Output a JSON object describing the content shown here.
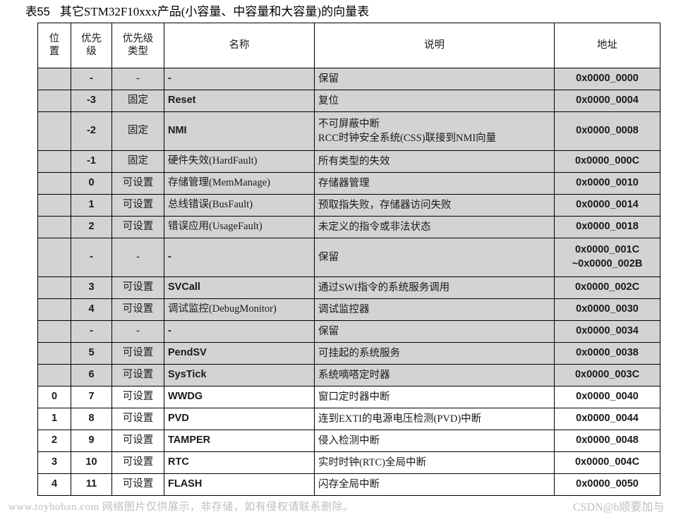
{
  "caption": {
    "number": "表55",
    "text": "其它STM32F10xxx产品(小容量、中容量和大容量)的向量表"
  },
  "table": {
    "headers": {
      "position_l1": "位",
      "position_l2": "置",
      "priority_l1": "优先",
      "priority_l2": "级",
      "priority_type_l1": "优先级",
      "priority_type_l2": "类型",
      "name": "名称",
      "description": "说明",
      "address": "地址"
    },
    "rows": [
      {
        "position": "",
        "priority": "-",
        "priority_type": "-",
        "name": "-",
        "name_cjk": false,
        "desc_lines": [
          "保留"
        ],
        "addr_lines": [
          "0x0000_0000"
        ],
        "shaded": true,
        "tall": false
      },
      {
        "position": "",
        "priority": "-3",
        "priority_type": "固定",
        "name": "Reset",
        "name_cjk": false,
        "desc_lines": [
          "复位"
        ],
        "addr_lines": [
          "0x0000_0004"
        ],
        "shaded": true,
        "tall": false
      },
      {
        "position": "",
        "priority": "-2",
        "priority_type": "固定",
        "name": "NMI",
        "name_cjk": false,
        "desc_lines": [
          "不可屏蔽中断",
          "RCC时钟安全系统(CSS)联接到NMI向量"
        ],
        "addr_lines": [
          "0x0000_0008"
        ],
        "shaded": true,
        "tall": true
      },
      {
        "position": "",
        "priority": "-1",
        "priority_type": "固定",
        "name": "硬件失效(HardFault)",
        "name_cjk": true,
        "desc_lines": [
          "所有类型的失效"
        ],
        "addr_lines": [
          "0x0000_000C"
        ],
        "shaded": true,
        "tall": false
      },
      {
        "position": "",
        "priority": "0",
        "priority_type": "可设置",
        "name": "存储管理(MemManage)",
        "name_cjk": true,
        "desc_lines": [
          "存储器管理"
        ],
        "addr_lines": [
          "0x0000_0010"
        ],
        "shaded": true,
        "tall": false
      },
      {
        "position": "",
        "priority": "1",
        "priority_type": "可设置",
        "name": "总线错误(BusFault)",
        "name_cjk": true,
        "desc_lines": [
          "预取指失败，存储器访问失败"
        ],
        "addr_lines": [
          "0x0000_0014"
        ],
        "shaded": true,
        "tall": false
      },
      {
        "position": "",
        "priority": "2",
        "priority_type": "可设置",
        "name": "错误应用(UsageFault)",
        "name_cjk": true,
        "desc_lines": [
          "未定义的指令或非法状态"
        ],
        "addr_lines": [
          "0x0000_0018"
        ],
        "shaded": true,
        "tall": false
      },
      {
        "position": "",
        "priority": "-",
        "priority_type": "-",
        "name": "-",
        "name_cjk": false,
        "desc_lines": [
          "保留"
        ],
        "addr_lines": [
          "0x0000_001C",
          "~0x0000_002B"
        ],
        "shaded": true,
        "tall": true
      },
      {
        "position": "",
        "priority": "3",
        "priority_type": "可设置",
        "name": "SVCall",
        "name_cjk": false,
        "desc_lines": [
          "通过SWI指令的系统服务调用"
        ],
        "addr_lines": [
          "0x0000_002C"
        ],
        "shaded": true,
        "tall": false
      },
      {
        "position": "",
        "priority": "4",
        "priority_type": "可设置",
        "name": "调试监控(DebugMonitor)",
        "name_cjk": true,
        "desc_lines": [
          "调试监控器"
        ],
        "addr_lines": [
          "0x0000_0030"
        ],
        "shaded": true,
        "tall": false
      },
      {
        "position": "",
        "priority": "-",
        "priority_type": "-",
        "name": "-",
        "name_cjk": false,
        "desc_lines": [
          "保留"
        ],
        "addr_lines": [
          "0x0000_0034"
        ],
        "shaded": true,
        "tall": false
      },
      {
        "position": "",
        "priority": "5",
        "priority_type": "可设置",
        "name": "PendSV",
        "name_cjk": false,
        "desc_lines": [
          "可挂起的系统服务"
        ],
        "addr_lines": [
          "0x0000_0038"
        ],
        "shaded": true,
        "tall": false
      },
      {
        "position": "",
        "priority": "6",
        "priority_type": "可设置",
        "name": "SysTick",
        "name_cjk": false,
        "desc_lines": [
          "系统嘀嗒定时器"
        ],
        "addr_lines": [
          "0x0000_003C"
        ],
        "shaded": true,
        "tall": false
      },
      {
        "position": "0",
        "priority": "7",
        "priority_type": "可设置",
        "name": "WWDG",
        "name_cjk": false,
        "desc_lines": [
          "窗口定时器中断"
        ],
        "addr_lines": [
          "0x0000_0040"
        ],
        "shaded": false,
        "tall": false
      },
      {
        "position": "1",
        "priority": "8",
        "priority_type": "可设置",
        "name": "PVD",
        "name_cjk": false,
        "desc_lines": [
          "连到EXTI的电源电压检测(PVD)中断"
        ],
        "addr_lines": [
          "0x0000_0044"
        ],
        "shaded": false,
        "tall": false
      },
      {
        "position": "2",
        "priority": "9",
        "priority_type": "可设置",
        "name": "TAMPER",
        "name_cjk": false,
        "desc_lines": [
          "侵入检测中断"
        ],
        "addr_lines": [
          "0x0000_0048"
        ],
        "shaded": false,
        "tall": false
      },
      {
        "position": "3",
        "priority": "10",
        "priority_type": "可设置",
        "name": "RTC",
        "name_cjk": false,
        "desc_lines": [
          "实时时钟(RTC)全局中断"
        ],
        "addr_lines": [
          "0x0000_004C"
        ],
        "shaded": false,
        "tall": false
      },
      {
        "position": "4",
        "priority": "11",
        "priority_type": "可设置",
        "name": "FLASH",
        "name_cjk": false,
        "desc_lines": [
          "闪存全局中断"
        ],
        "addr_lines": [
          "0x0000_0050"
        ],
        "shaded": false,
        "tall": false
      }
    ]
  },
  "watermarks": {
    "bottom_left": "www.toyhoban.com 网络图片仅供展示，非存储，如有侵权请联系删除。",
    "bottom_right": "CSDN@b顺要加与"
  }
}
